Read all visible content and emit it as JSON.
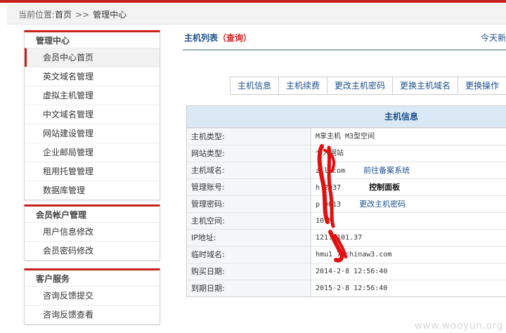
{
  "breadcrumb": {
    "label": "当前位置:",
    "home": "首页",
    "separator": ">>",
    "current": "管理中心"
  },
  "sidebar": [
    {
      "title": "管理中心",
      "items": [
        "会员中心首页",
        "英文域名管理",
        "虚拟主机管理",
        "中文域名管理",
        "网站建设管理",
        "企业邮局管理",
        "租用托管管理",
        "数据库管理"
      ],
      "active_index": 0
    },
    {
      "title": "会员帐户管理",
      "items": [
        "用户信息修改",
        "会员密码修改"
      ]
    },
    {
      "title": "客户服务",
      "items": [
        "咨询反馈提交",
        "咨询反馈查看"
      ]
    }
  ],
  "main": {
    "title": "主机列表",
    "title_action": "（查询）",
    "today_label": "今天新",
    "tabs": [
      "主机信息",
      "主机续费",
      "更改主机密码",
      "更换主机域名",
      "更换操作"
    ],
    "panel_title": "主机信息",
    "rows": [
      {
        "key": "主机类型:",
        "value": "M享主机 M3型空间"
      },
      {
        "key": "网站类型:",
        "value": "个人网站"
      },
      {
        "key": "主机域名:",
        "value": "z    l.com",
        "link": "前往备案系统"
      },
      {
        "key": "管理账号:",
        "value": "h    2037",
        "bold": "控制面板"
      },
      {
        "key": "管理密码:",
        "value": "p    0613",
        "link": "更改主机密码"
      },
      {
        "key": "主机空间:",
        "value": "10   M"
      },
      {
        "key": "IP地址:",
        "value": "121.   101.37"
      },
      {
        "key": "临时域名:",
        "value": "hmu1  7.chinaw3.com"
      },
      {
        "key": "购买日期:",
        "value": "2014-2-8 12:56:40"
      },
      {
        "key": "到期日期:",
        "value": "2015-2-8 12:56:40"
      }
    ]
  },
  "colors": {
    "accent": "#c8201c",
    "link": "#1d4f8e",
    "redaction": "#e01010",
    "header_bg": "#dbe8f5"
  },
  "watermark": "www.wooyun.org"
}
